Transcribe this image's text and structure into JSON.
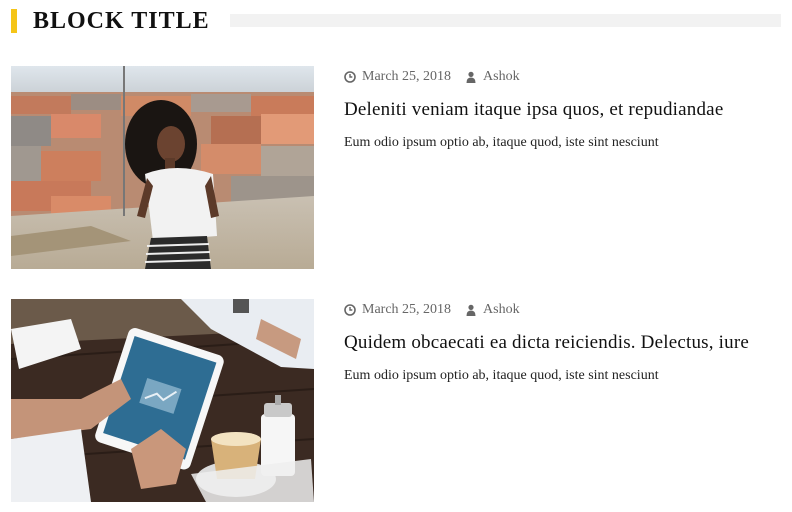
{
  "block": {
    "title": "BLOCK TITLE",
    "accent_color": "#f5c518"
  },
  "posts": [
    {
      "image": "woman-city-rooftop-photo",
      "date": "March 25, 2018",
      "author": "Ashok",
      "title": "Deleniti veniam itaque ipsa quos, et repudiandae",
      "excerpt": "Eum odio ipsum optio ab, itaque quod, iste sint nesciunt"
    },
    {
      "image": "tablet-coffee-table-photo",
      "date": "March 25, 2018",
      "author": "Ashok",
      "title": "Quidem obcaecati ea dicta reiciendis. Delectus, iure",
      "excerpt": "Eum odio ipsum optio ab, itaque quod, iste sint nesciunt"
    }
  ],
  "icons": {
    "date": "clock-icon",
    "author": "user-icon"
  }
}
